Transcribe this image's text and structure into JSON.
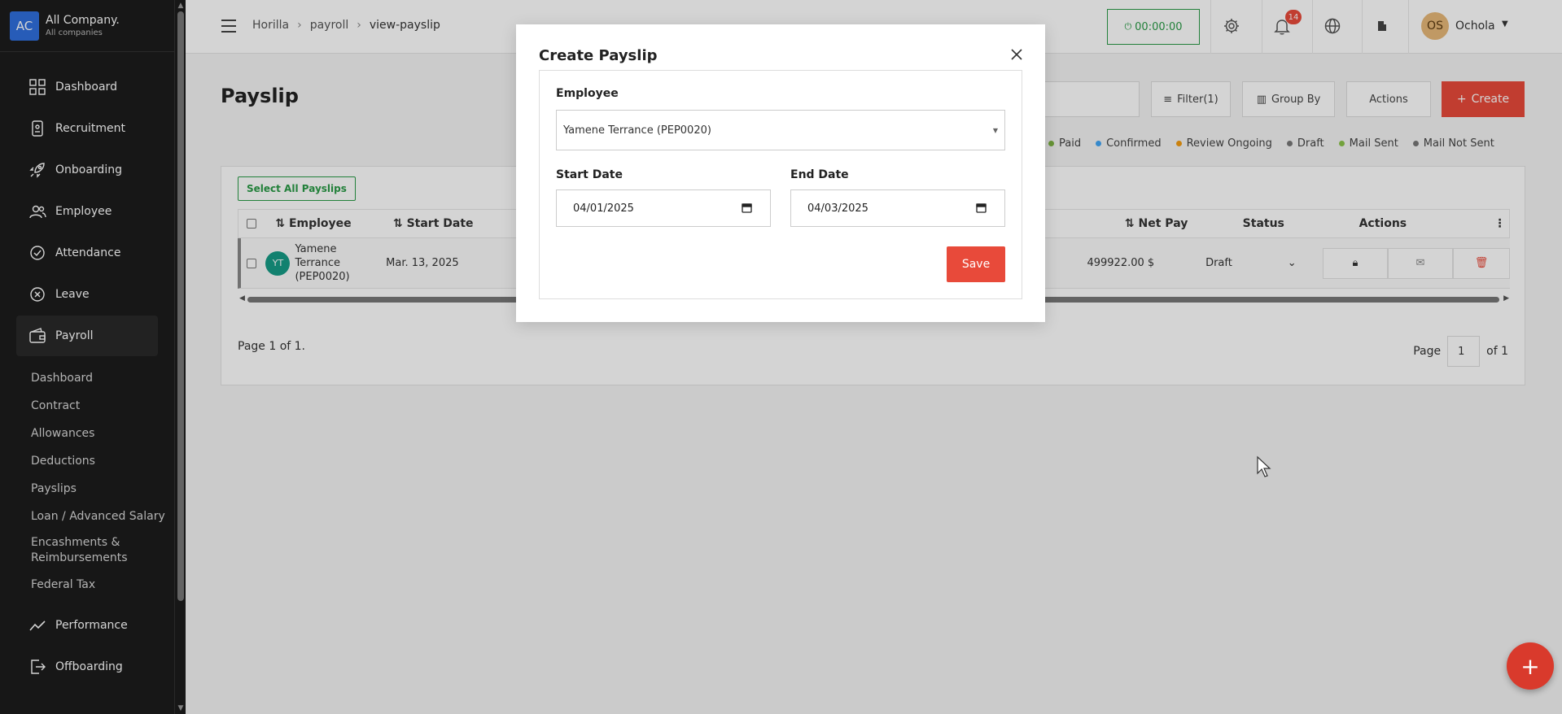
{
  "company": {
    "logo": "AC",
    "name": "All Company.",
    "sub": "All companies"
  },
  "sidebar": {
    "items": [
      {
        "label": "Dashboard",
        "icon": "dashboard-icon"
      },
      {
        "label": "Recruitment",
        "icon": "recruitment-icon"
      },
      {
        "label": "Onboarding",
        "icon": "rocket-icon"
      },
      {
        "label": "Employee",
        "icon": "users-icon"
      },
      {
        "label": "Attendance",
        "icon": "check-circle-icon"
      },
      {
        "label": "Leave",
        "icon": "x-circle-icon"
      },
      {
        "label": "Payroll",
        "icon": "wallet-icon"
      }
    ],
    "payroll_sub": [
      "Dashboard",
      "Contract",
      "Allowances",
      "Deductions",
      "Payslips",
      "Loan / Advanced Salary",
      "Encashments & Reimbursements",
      "Federal Tax"
    ],
    "items_after": [
      {
        "label": "Performance",
        "icon": "trend-icon"
      },
      {
        "label": "Offboarding",
        "icon": "exit-icon"
      }
    ]
  },
  "header": {
    "breadcrumb": [
      "Horilla",
      "payroll",
      "view-payslip"
    ],
    "timer": "00:00:00",
    "notifications_count": "14",
    "user_initials": "OS",
    "user_name": "Ochola"
  },
  "page": {
    "title": "Payslip",
    "filter_label": "Filter(1)",
    "groupby_label": "Group By",
    "actions_label": "Actions",
    "create_label": "Create",
    "legend": [
      {
        "label": "Paid",
        "color": "#7cb342"
      },
      {
        "label": "Confirmed",
        "color": "#42a5f5"
      },
      {
        "label": "Review Ongoing",
        "color": "#f39c12"
      },
      {
        "label": "Draft",
        "color": "#777777"
      },
      {
        "label": "Mail Sent",
        "color": "#8bc34a"
      },
      {
        "label": "Mail Not Sent",
        "color": "#777777"
      }
    ],
    "select_all": "Select All Payslips",
    "columns": {
      "employee": "Employee",
      "start_date": "Start Date",
      "net_pay": "Net Pay",
      "status": "Status",
      "actions": "Actions"
    },
    "row": {
      "initials": "YT",
      "name": "Yamene Terrance (PEP0020)",
      "start_date": "Mar. 13, 2025",
      "net_pay": "499922.00 $",
      "status": "Draft"
    },
    "page_info": "Page 1 of 1.",
    "pager": {
      "label": "Page",
      "current": "1",
      "of": "of 1"
    }
  },
  "modal": {
    "title": "Create Payslip",
    "employee_label": "Employee",
    "employee_value": "Yamene Terrance (PEP0020)",
    "start_label": "Start Date",
    "start_value": "04/01/2025",
    "end_label": "End Date",
    "end_value": "04/03/2025",
    "save_label": "Save"
  }
}
